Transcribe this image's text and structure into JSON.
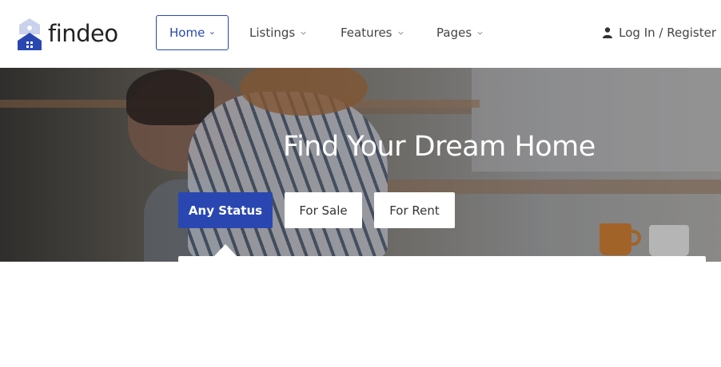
{
  "brand": {
    "name": "findeo"
  },
  "nav": {
    "items": [
      {
        "label": "Home",
        "active": true
      },
      {
        "label": "Listings",
        "active": false
      },
      {
        "label": "Features",
        "active": false
      },
      {
        "label": "Pages",
        "active": false
      }
    ],
    "login_label": "Log In / Register"
  },
  "hero": {
    "title": "Find Your Dream Home",
    "tabs": [
      {
        "label": "Any Status",
        "selected": true
      },
      {
        "label": "For Sale",
        "selected": false
      },
      {
        "label": "For Rent",
        "selected": false
      }
    ]
  },
  "colors": {
    "accent": "#2a47b1",
    "white": "#ffffff",
    "text": "#444444"
  },
  "icons": {
    "nav_dropdown": "chevron-down-icon",
    "login": "user-icon",
    "logo": "house-logo-icon"
  }
}
